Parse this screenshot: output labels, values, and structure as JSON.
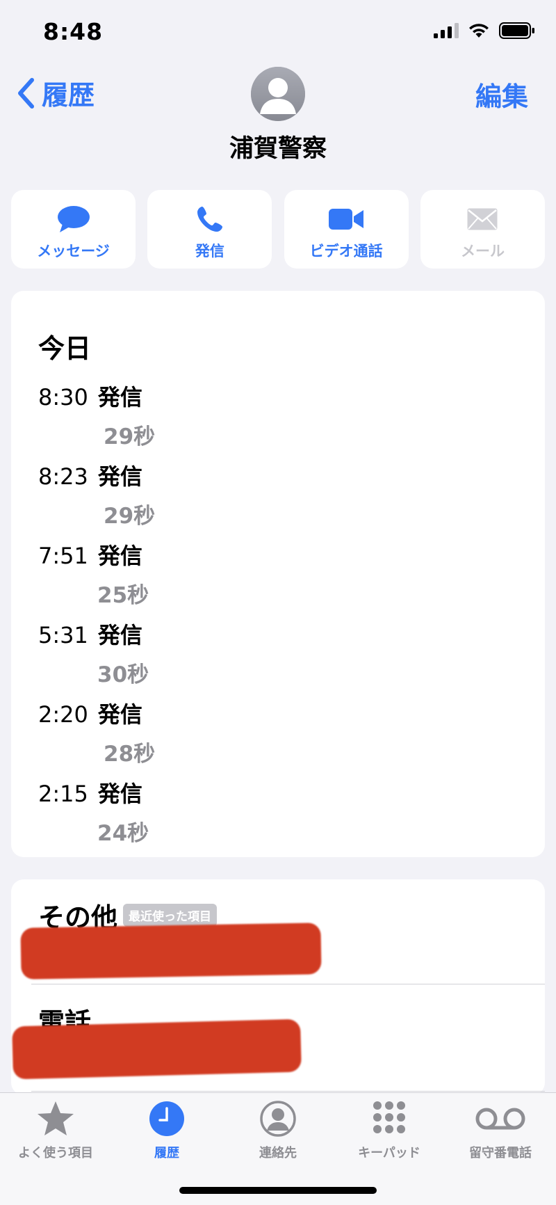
{
  "status_bar": {
    "time": "8:48"
  },
  "nav": {
    "back_label": "履歴",
    "edit_label": "編集"
  },
  "contact": {
    "name": "浦賀警察"
  },
  "actions": [
    {
      "label": "メッセージ",
      "icon": "message-bubble-icon"
    },
    {
      "label": "発信",
      "icon": "phone-icon"
    },
    {
      "label": "ビデオ通話",
      "icon": "video-icon"
    },
    {
      "label": "メール",
      "icon": "envelope-icon",
      "disabled": true
    }
  ],
  "history": {
    "title": "今日",
    "entries": [
      {
        "time": "8:30",
        "kind": "発信",
        "duration": "29秒"
      },
      {
        "time": "8:23",
        "kind": "発信",
        "duration": "29秒"
      },
      {
        "time": "7:51",
        "kind": "発信",
        "duration": "25秒"
      },
      {
        "time": "5:31",
        "kind": "発信",
        "duration": "30秒"
      },
      {
        "time": "2:20",
        "kind": "発信",
        "duration": "28秒"
      },
      {
        "time": "2:15",
        "kind": "発信",
        "duration": "24秒"
      }
    ]
  },
  "other": {
    "title": "その他",
    "badge": "最近使った項目",
    "phone_title": "電話"
  },
  "tabbar": {
    "items": [
      {
        "label": "よく使う項目",
        "icon": "star-icon"
      },
      {
        "label": "履歴",
        "icon": "clock-icon",
        "active": true
      },
      {
        "label": "連絡先",
        "icon": "person-circle-icon"
      },
      {
        "label": "キーパッド",
        "icon": "keypad-icon"
      },
      {
        "label": "留守番電話",
        "icon": "voicemail-icon"
      }
    ]
  },
  "colors": {
    "accent": "#3478f6",
    "background": "#f2f2f7",
    "redaction": "#d13b22",
    "secondary_text": "#8e8e93"
  }
}
